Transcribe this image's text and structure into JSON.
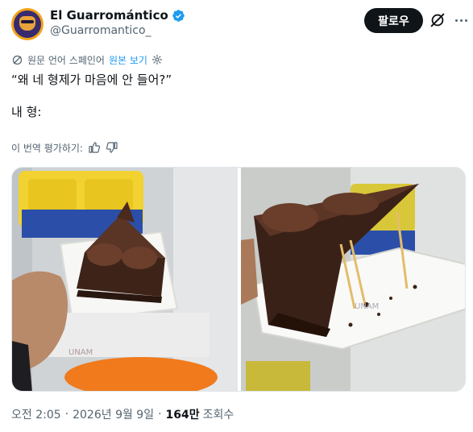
{
  "author": {
    "display_name": "El Guarromántico",
    "handle": "@Guarromantico_"
  },
  "header": {
    "follow_label": "팔로우"
  },
  "translation": {
    "notice": "원문 언어 스페인어",
    "view_original": "원본 보기"
  },
  "tweet": {
    "text": "“왜 네 형제가 마음에 안 들어?”\n\n내 형:"
  },
  "rate": {
    "label": "이 번역 평가하기:"
  },
  "media": {
    "watermark_text": "UNAM"
  },
  "meta": {
    "time": "오전 2:05",
    "separator": "·",
    "date": "2026년 9월 9일",
    "views_count": "164만",
    "views_label": "조회수"
  },
  "colors": {
    "accent": "#1d9bf0",
    "text_primary": "#0f1419",
    "text_secondary": "#536471",
    "follow_button_bg": "#0f1419"
  },
  "icons": {
    "verified": "verified-badge-icon",
    "grok": "grok-icon",
    "more": "more-icon",
    "globe": "globe-translate-icon",
    "settings": "gear-icon",
    "thumbs_up": "thumbs-up-icon",
    "thumbs_down": "thumbs-down-icon"
  }
}
